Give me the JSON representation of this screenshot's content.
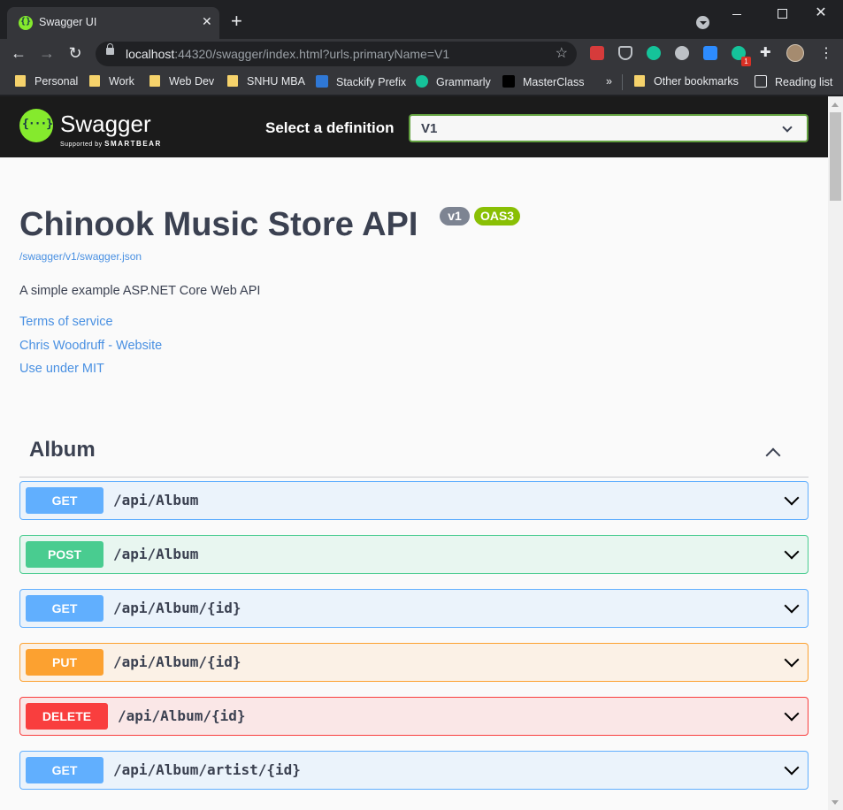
{
  "browser": {
    "tab_title": "Swagger UI",
    "tab_close": "✕",
    "new_tab": "+",
    "url_host": "localhost",
    "url_rest": ":44320/swagger/index.html?urls.primaryName=V1",
    "window_close": "✕",
    "extension_badge": "1",
    "bookmarks": [
      "Personal",
      "Work",
      "Web Dev",
      "SNHU MBA",
      "Stackify Prefix",
      "Grammarly",
      "MasterClass"
    ],
    "overflow": "»",
    "other_bookmarks": "Other bookmarks",
    "reading_list": "Reading list"
  },
  "swagger": {
    "brand": "Swagger",
    "supported_by": "Supported by",
    "smartbear": "SMARTBEAR",
    "definition_label": "Select a definition",
    "definition_value": "V1",
    "title": "Chinook Music Store API",
    "version_badge": "v1",
    "oas_badge": "OAS3",
    "spec_url": "/swagger/v1/swagger.json",
    "description": "A simple example ASP.NET Core Web API",
    "links": [
      "Terms of service",
      "Chris Woodruff - Website",
      "Use under MIT"
    ],
    "tag": "Album",
    "operations": [
      {
        "method": "GET",
        "path": "/api/Album"
      },
      {
        "method": "POST",
        "path": "/api/Album"
      },
      {
        "method": "GET",
        "path": "/api/Album/{id}"
      },
      {
        "method": "PUT",
        "path": "/api/Album/{id}"
      },
      {
        "method": "DELETE",
        "path": "/api/Album/{id}"
      },
      {
        "method": "GET",
        "path": "/api/Album/artist/{id}"
      }
    ]
  },
  "colors": {
    "get": "#61affe",
    "post": "#49cc90",
    "put": "#fca130",
    "delete": "#f93e3e",
    "swagger_green": "#85ea2d"
  }
}
